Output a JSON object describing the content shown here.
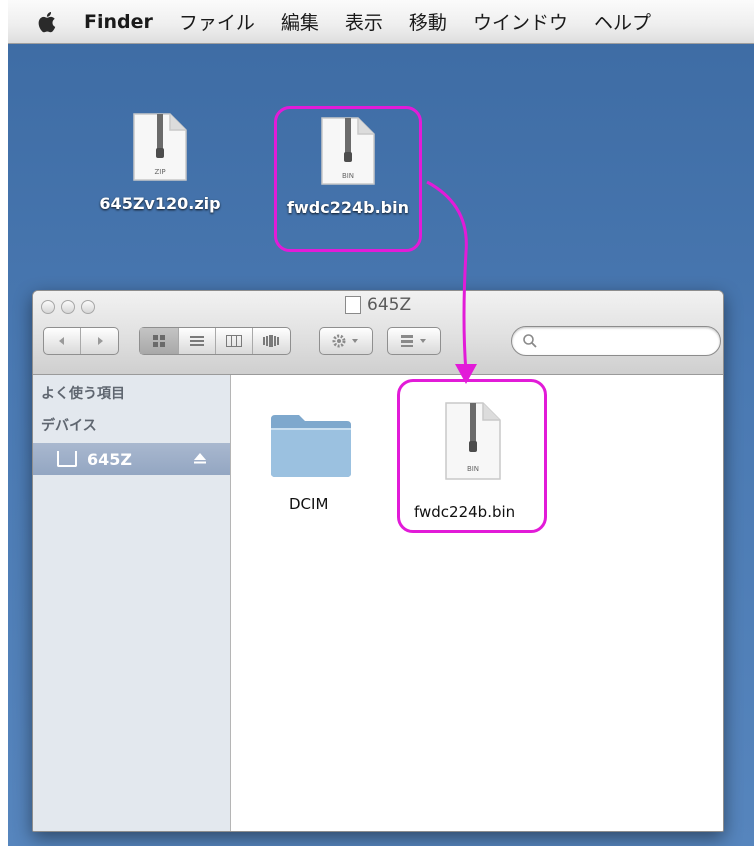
{
  "menubar": {
    "items": [
      "Finder",
      "ファイル",
      "編集",
      "表示",
      "移動",
      "ウインドウ",
      "ヘルプ"
    ]
  },
  "desktop": {
    "icons": [
      {
        "label": "645Zv120.zip",
        "type_tag": "ZIP"
      },
      {
        "label": "fwdc224b.bin",
        "type_tag": "BIN"
      }
    ]
  },
  "finder": {
    "title": "645Z",
    "search_placeholder": "",
    "sidebar": {
      "favorites_heading": "よく使う項目",
      "devices_heading": "デバイス",
      "device_label": "645Z"
    },
    "files": [
      {
        "label": "DCIM",
        "kind": "folder-icon"
      },
      {
        "label": "fwdc224b.bin",
        "kind": "bin-file-icon",
        "type_tag": "BIN"
      }
    ]
  },
  "colors": {
    "desktop": "#4a79b2",
    "highlight": "#e21bd8",
    "sidebar_selected": "#9fb0ca"
  }
}
